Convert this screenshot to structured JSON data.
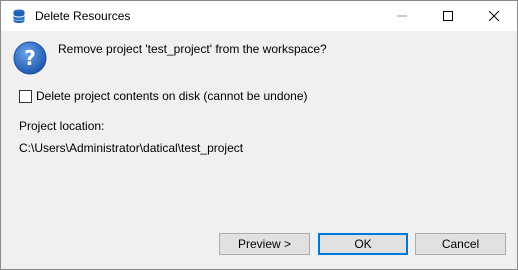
{
  "window": {
    "title": "Delete Resources"
  },
  "dialog": {
    "icon": "question-icon",
    "message": "Remove project 'test_project' from the workspace?",
    "checkbox": {
      "label": "Delete project contents on disk (cannot be undone)",
      "checked": false
    },
    "location_label": "Project location:",
    "location_value": "C:\\Users\\Administrator\\datical\\test_project"
  },
  "buttons": {
    "preview": "Preview >",
    "ok": "OK",
    "cancel": "Cancel"
  },
  "colors": {
    "accent": "#0078d7",
    "question_icon": "#2d6cc0"
  }
}
